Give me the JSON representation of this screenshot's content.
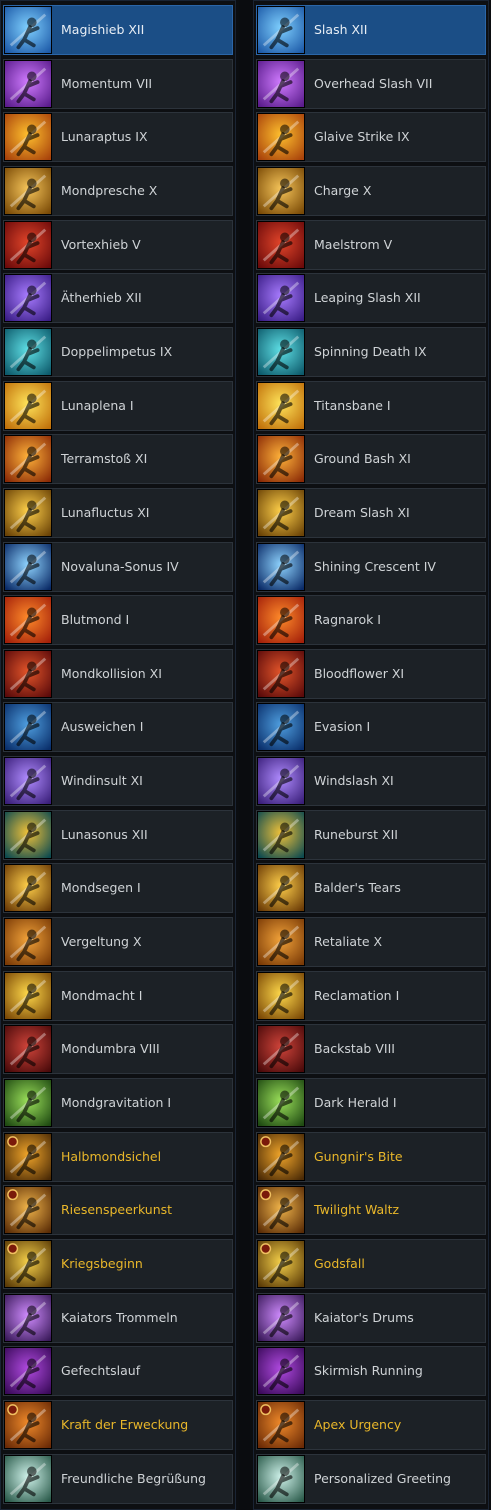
{
  "rows": [
    {
      "left": "Magishieb XII",
      "right": "Slash XII",
      "icon": "slash-blue-icon",
      "c1": "#1d5aa8",
      "c2": "#7fd0ff",
      "selected": true
    },
    {
      "left": "Momentum VII",
      "right": "Overhead Slash VII",
      "icon": "overhead-slash-icon",
      "c1": "#5a1c8c",
      "c2": "#d07bff"
    },
    {
      "left": "Lunaraptus IX",
      "right": "Glaive Strike IX",
      "icon": "glaive-strike-icon",
      "c1": "#a8420b",
      "c2": "#ffc02e"
    },
    {
      "left": "Mondpresche X",
      "right": "Charge X",
      "icon": "charge-icon",
      "c1": "#7a4a06",
      "c2": "#f6c55a"
    },
    {
      "left": "Vortexhieb V",
      "right": "Maelstrom V",
      "icon": "maelstrom-icon",
      "c1": "#6b0a0a",
      "c2": "#e2452a"
    },
    {
      "left": "Ätherhieb XII",
      "right": "Leaping Slash XII",
      "icon": "leaping-slash-icon",
      "c1": "#3a1d86",
      "c2": "#a87cff"
    },
    {
      "left": "Doppelimpetus IX",
      "right": "Spinning Death IX",
      "icon": "spinning-death-icon",
      "c1": "#0d5a6b",
      "c2": "#5fe0e6"
    },
    {
      "left": "Lunaplena I",
      "right": "Titansbane I",
      "icon": "sun-orb-icon",
      "c1": "#c0700a",
      "c2": "#ffe45a"
    },
    {
      "left": "Terramstoß XI",
      "right": "Ground Bash XI",
      "icon": "ground-bash-icon",
      "c1": "#8a2a06",
      "c2": "#ffb23a"
    },
    {
      "left": "Lunafluctus XI",
      "right": "Dream Slash XI",
      "icon": "dream-slash-icon",
      "c1": "#6a4206",
      "c2": "#ffd04a"
    },
    {
      "left": "Novaluna-Sonus IV",
      "right": "Shining Crescent IV",
      "icon": "crescent-moon-icon",
      "c1": "#0a2a66",
      "c2": "#8fd4ff"
    },
    {
      "left": "Blutmond I",
      "right": "Ragnarok I",
      "icon": "red-sun-icon",
      "c1": "#a3200a",
      "c2": "#ff8a2a"
    },
    {
      "left": "Mondkollision XI",
      "right": "Bloodflower XI",
      "icon": "bloodflower-icon",
      "c1": "#5a0a0a",
      "c2": "#e3552a"
    },
    {
      "left": "Ausweichen I",
      "right": "Evasion I",
      "icon": "evasion-icon",
      "c1": "#0a2f6b",
      "c2": "#4f9fe0"
    },
    {
      "left": "Windinsult XI",
      "right": "Windslash XI",
      "icon": "windslash-icon",
      "c1": "#3a1f7a",
      "c2": "#b08cff"
    },
    {
      "left": "Lunasonus XII",
      "right": "Runeburst XII",
      "icon": "runeburst-icon",
      "c1": "#0d4a4f",
      "c2": "#f0c23a"
    },
    {
      "left": "Mondsegen I",
      "right": "Balder's Tears",
      "icon": "balders-tears-icon",
      "c1": "#6a3a06",
      "c2": "#ffcf4a"
    },
    {
      "left": "Vergeltung X",
      "right": "Retaliate X",
      "icon": "retaliate-icon",
      "c1": "#7a3a06",
      "c2": "#f2a33a"
    },
    {
      "left": "Mondmacht I",
      "right": "Reclamation I",
      "icon": "reclamation-icon",
      "c1": "#7a4806",
      "c2": "#ffd84a"
    },
    {
      "left": "Mondumbra VIII",
      "right": "Backstab VIII",
      "icon": "backstab-icon",
      "c1": "#4a0a0a",
      "c2": "#d0443a"
    },
    {
      "left": "Mondgravitation I",
      "right": "Dark Herald I",
      "icon": "dark-herald-icon",
      "c1": "#1f4a12",
      "c2": "#9be05a"
    },
    {
      "left": "Halbmondsichel",
      "right": "Gungnir's Bite",
      "icon": "gungnirs-bite-icon",
      "c1": "#4a2a06",
      "c2": "#f0a52a",
      "gold": true
    },
    {
      "left": "Riesenspeerkunst",
      "right": "Twilight Waltz",
      "icon": "twilight-waltz-icon",
      "c1": "#5a2c06",
      "c2": "#f0b44a",
      "gold": true
    },
    {
      "left": "Kriegsbeginn",
      "right": "Godsfall",
      "icon": "godsfall-icon",
      "c1": "#5a3a06",
      "c2": "#f5d04a",
      "gold": true
    },
    {
      "left": "Kaiators Trommeln",
      "right": "Kaiator's Drums",
      "icon": "kaiators-drums-icon",
      "c1": "#3a1a5a",
      "c2": "#d08cff"
    },
    {
      "left": "Gefechtslauf",
      "right": "Skirmish Running",
      "icon": "skirmish-running-icon",
      "c1": "#3a0a5a",
      "c2": "#b04ae0"
    },
    {
      "left": "Kraft der Erweckung",
      "right": "Apex Urgency",
      "icon": "apex-urgency-icon",
      "c1": "#6a2a06",
      "c2": "#f08a2a",
      "gold": true
    },
    {
      "left": "Freundliche Begrüßung",
      "right": "Personalized Greeting",
      "icon": "greeting-icon",
      "c1": "#2a5a4a",
      "c2": "#cff2ea"
    }
  ]
}
